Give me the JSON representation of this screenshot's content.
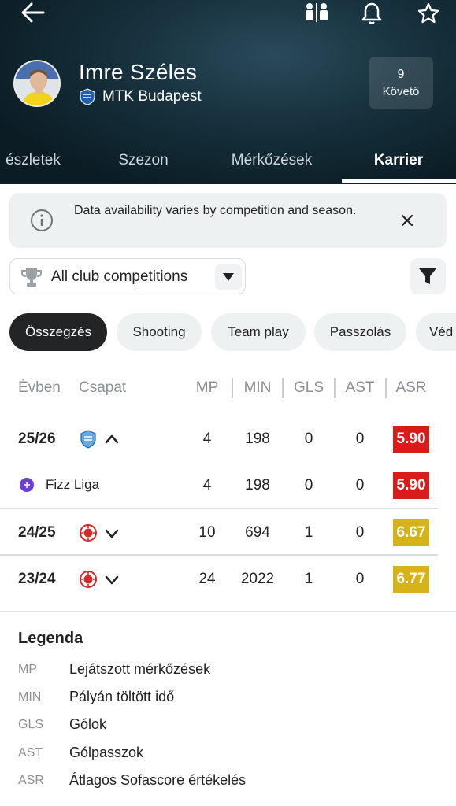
{
  "header": {
    "player_name": "Imre Széles",
    "team_name": "MTK Budapest",
    "followers_count": "9",
    "followers_label": "Követő",
    "tabs": [
      {
        "label": "észletek"
      },
      {
        "label": "Szezon"
      },
      {
        "label": "Mérkőzések"
      },
      {
        "label": "Karrier",
        "active": true
      }
    ]
  },
  "info_banner": {
    "text": "Data availability varies by competition and season."
  },
  "competition_select": {
    "value": "All club competitions"
  },
  "chips": [
    {
      "label": "Összegzés",
      "active": true
    },
    {
      "label": "Shooting"
    },
    {
      "label": "Team play"
    },
    {
      "label": "Passzolás"
    },
    {
      "label": "Véd"
    }
  ],
  "table": {
    "headers": {
      "year": "Évben",
      "team": "Csapat",
      "mp": "MP",
      "min": "MIN",
      "gls": "GLS",
      "ast": "AST",
      "asr": "ASR"
    },
    "rows": [
      {
        "season": "25/26",
        "team_icon": "mtk-logo-icon",
        "expander": "chevron-up-icon",
        "mp": "4",
        "min": "198",
        "gls": "0",
        "ast": "0",
        "asr": "5.90",
        "asr_color": "#d91b1b"
      },
      {
        "competition": "Fizz Liga",
        "comp_icon": "fizz-liga-icon",
        "mp": "4",
        "min": "198",
        "gls": "0",
        "ast": "0",
        "asr": "5.90",
        "asr_color": "#d91b1b"
      },
      {
        "season": "24/25",
        "team_icon": "red-crest-icon",
        "expander": "chevron-down-icon",
        "mp": "10",
        "min": "694",
        "gls": "1",
        "ast": "0",
        "asr": "6.67",
        "asr_color": "#d6b319"
      },
      {
        "season": "23/24",
        "team_icon": "red-crest-icon",
        "expander": "chevron-down-icon",
        "mp": "24",
        "min": "2022",
        "gls": "1",
        "ast": "0",
        "asr": "6.77",
        "asr_color": "#d6b319"
      }
    ]
  },
  "legend": {
    "title": "Legenda",
    "items": [
      {
        "abbr": "MP",
        "desc": "Lejátszott mérkőzések"
      },
      {
        "abbr": "MIN",
        "desc": "Pályán töltött idő"
      },
      {
        "abbr": "GLS",
        "desc": "Gólok"
      },
      {
        "abbr": "AST",
        "desc": "Gólpasszok"
      },
      {
        "abbr": "ASR",
        "desc": "Átlagos Sofascore értékelés"
      }
    ]
  }
}
